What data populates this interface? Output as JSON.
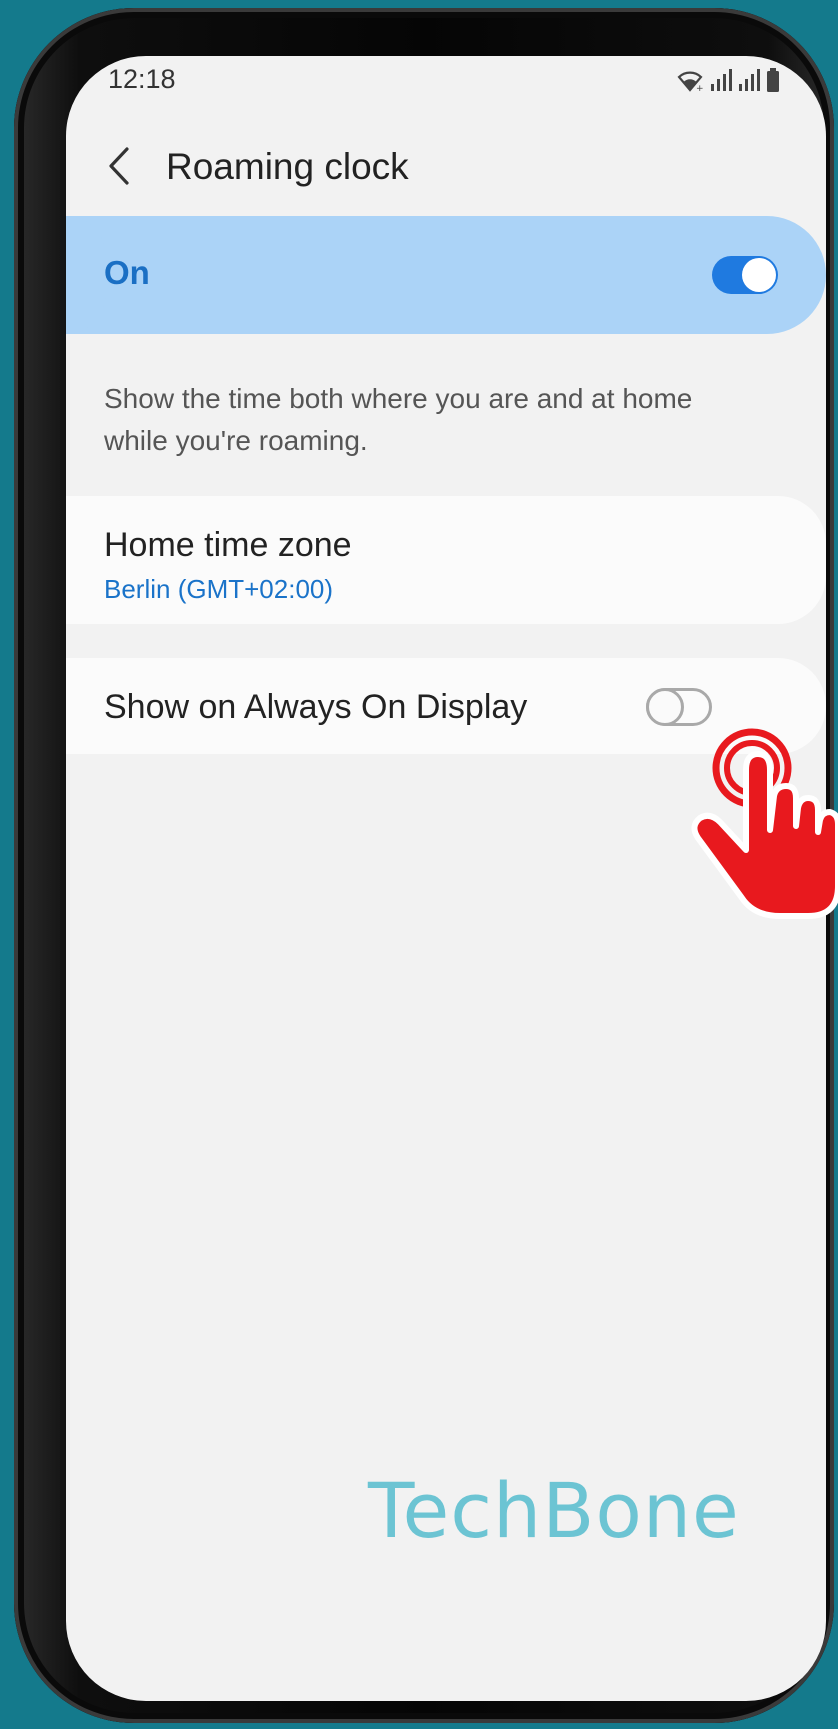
{
  "status_bar": {
    "time": "12:18",
    "icons": [
      "wifi-icon",
      "signal-icon",
      "signal-icon",
      "battery-icon"
    ]
  },
  "header": {
    "back_icon": "chevron-left-icon",
    "title": "Roaming clock"
  },
  "master_switch": {
    "label": "On",
    "state": true,
    "bg_color": "#abd3f7",
    "accent_color": "#1f7ae0"
  },
  "description": "Show the time both where you are and at home while you're roaming.",
  "settings": {
    "home_time_zone": {
      "title": "Home time zone",
      "value": "Berlin (GMT+02:00)"
    },
    "always_on_display": {
      "title": "Show on Always On Display",
      "state": false
    }
  },
  "overlay": {
    "tap_icon": "tap-hand-icon",
    "watermark": "TechBone"
  },
  "colors": {
    "background": "#147a8c",
    "screen": "#f2f2f2",
    "link": "#1a73c9",
    "watermark": "#6cc4d3",
    "hand": "#e8191e"
  }
}
